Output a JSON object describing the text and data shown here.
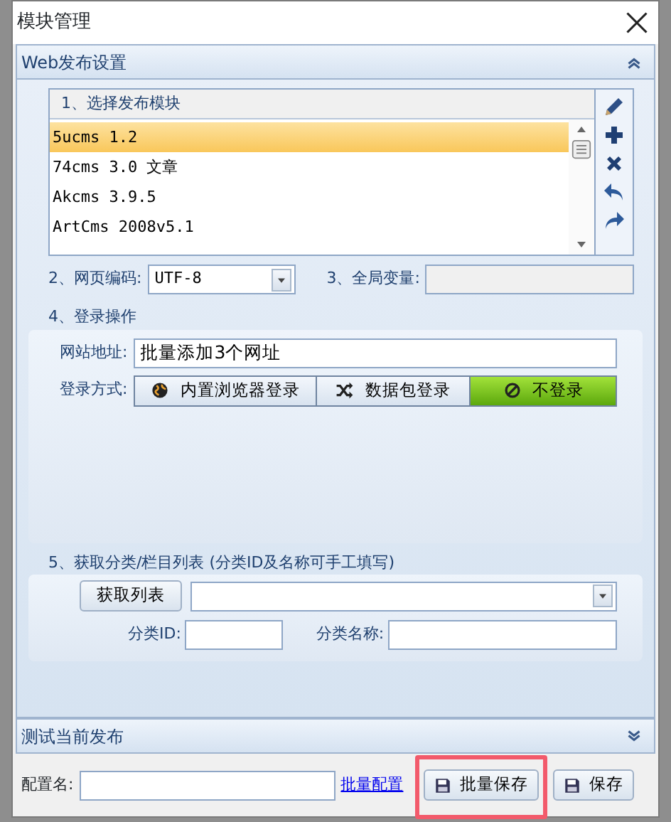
{
  "window": {
    "title": "模块管理"
  },
  "web_panel": {
    "title": "Web发布设置",
    "expanded": true
  },
  "module_list": {
    "header": "1、选择发布模块",
    "items": [
      {
        "label": "5ucms 1.2",
        "selected": true
      },
      {
        "label": "74cms 3.0 文章",
        "selected": false
      },
      {
        "label": "Akcms 3.9.5",
        "selected": false
      },
      {
        "label": "ArtCms 2008v5.1",
        "selected": false
      }
    ]
  },
  "encoding": {
    "label": "2、网页编码:",
    "value": "UTF-8"
  },
  "global_var": {
    "label": "3、全局变量:",
    "disabled": true
  },
  "login": {
    "title": "4、登录操作",
    "url_label": "网站地址:",
    "url_value": "批量添加3个网址",
    "method_label": "登录方式:",
    "methods": [
      {
        "label": "内置浏览器登录",
        "kind": "browser",
        "selected": false
      },
      {
        "label": "数据包登录",
        "kind": "packet",
        "selected": false
      },
      {
        "label": "不登录",
        "kind": "none",
        "selected": true
      }
    ]
  },
  "category": {
    "title": "5、获取分类/栏目列表 (分类ID及名称可手工填写)",
    "fetch_button": "获取列表",
    "id_label": "分类ID:",
    "name_label": "分类名称:"
  },
  "test_panel": {
    "title": "测试当前发布",
    "expanded": false
  },
  "footer": {
    "config_label": "配置名:",
    "batch_link": "批量配置",
    "batch_save": "批量保存",
    "save": "保存",
    "batch_save_highlighted": true
  }
}
